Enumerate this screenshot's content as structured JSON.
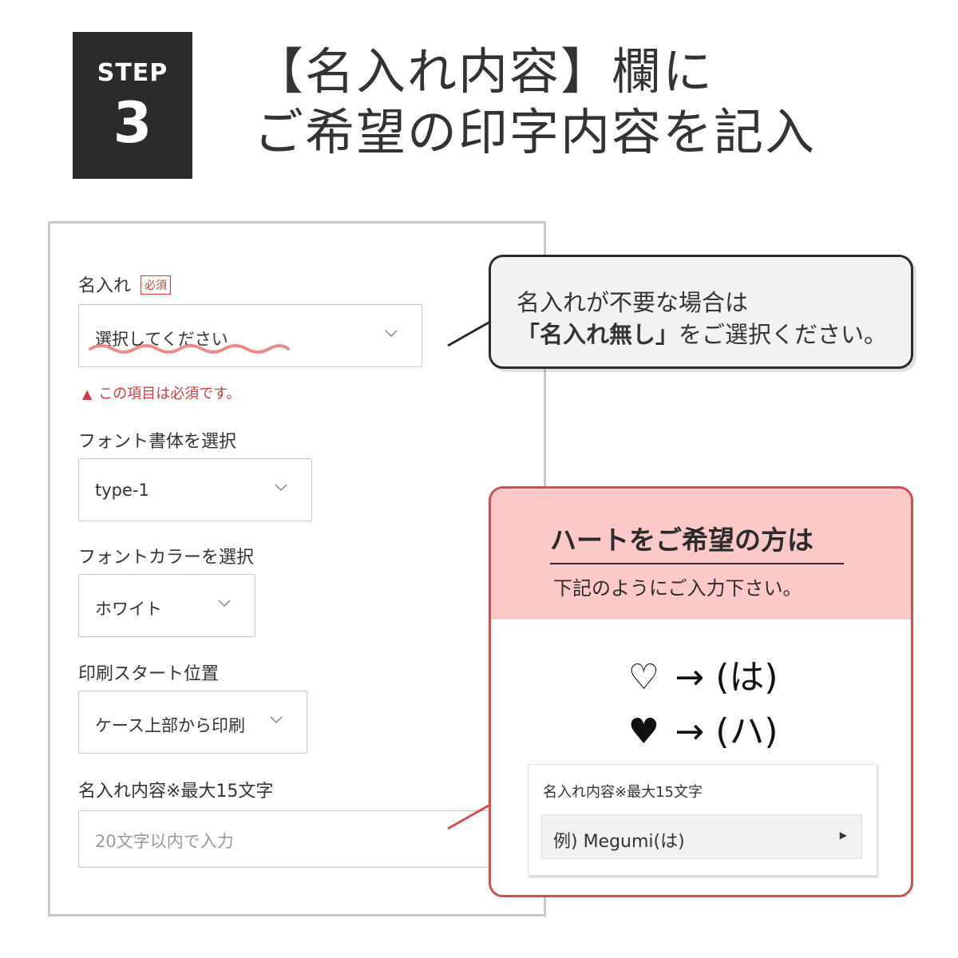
{
  "badge": {
    "word": "STEP",
    "number": "3"
  },
  "heading": {
    "line1": "【名入れ内容】欄に",
    "line2": "ご希望の印字内容を記入"
  },
  "form": {
    "name_field": {
      "label": "名入れ",
      "required": "必須",
      "value": "選択してください",
      "error": "この項目は必須です。"
    },
    "font_field": {
      "label": "フォント書体を選択",
      "value": "type-1"
    },
    "color_field": {
      "label": "フォントカラーを選択",
      "value": "ホワイト"
    },
    "position_field": {
      "label": "印刷スタート位置",
      "value": "ケース上部から印刷"
    },
    "content_field": {
      "label": "名入れ内容※最大15文字",
      "placeholder": "20文字以内で入力"
    }
  },
  "callout_top": {
    "line1": "名入れが不要な場合は",
    "line2_bold": "「名入れ無し」",
    "line2_rest": "をご選択ください。"
  },
  "callout_heart": {
    "title": "ハートをご希望の方は",
    "subtitle": "下記のようにご入力下さい。",
    "white_heart": "♡",
    "white_code": "(は)",
    "black_heart": "♥",
    "black_code": "(ハ)",
    "arrow": "→",
    "example_label": "名入れ内容※最大15文字",
    "example_value": "例) Megumi(は)"
  },
  "colors": {
    "badge_bg": "#2b2b2b",
    "accent_red": "#d34e4e",
    "heart_header_bg": "#fcc8c8",
    "squiggle": "#f08a8a",
    "error": "#d43a3a"
  }
}
